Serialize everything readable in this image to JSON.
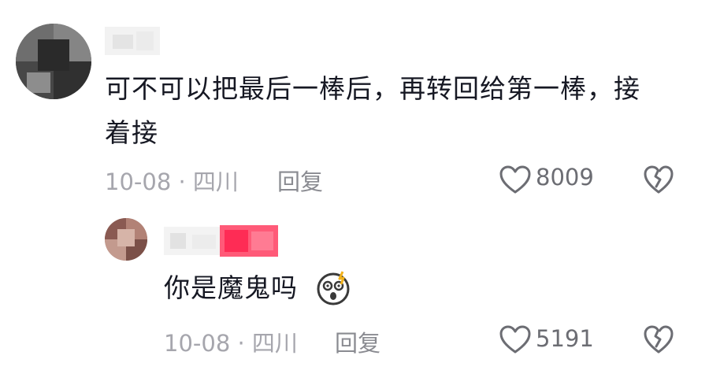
{
  "comment": {
    "text": "可不可以把最后一棒后，再转回给第一棒，接着接",
    "meta": "10-08 · 四川",
    "reply_label": "回复",
    "like_count": "8009",
    "like_icon": "heart-outline-icon",
    "dislike_icon": "broken-heart-icon"
  },
  "reply": {
    "text": "你是魔鬼吗",
    "emoji_icon": "shocked-face-emoji-icon",
    "meta": "10-08 · 四川",
    "reply_label": "回复",
    "like_count": "5191",
    "like_icon": "heart-outline-icon",
    "dislike_icon": "broken-heart-icon",
    "username_tag_color": "#fe2c55"
  },
  "colors": {
    "primary_text": "#161823",
    "meta_text": "#a6a6ad",
    "icon": "#6c6d73"
  }
}
